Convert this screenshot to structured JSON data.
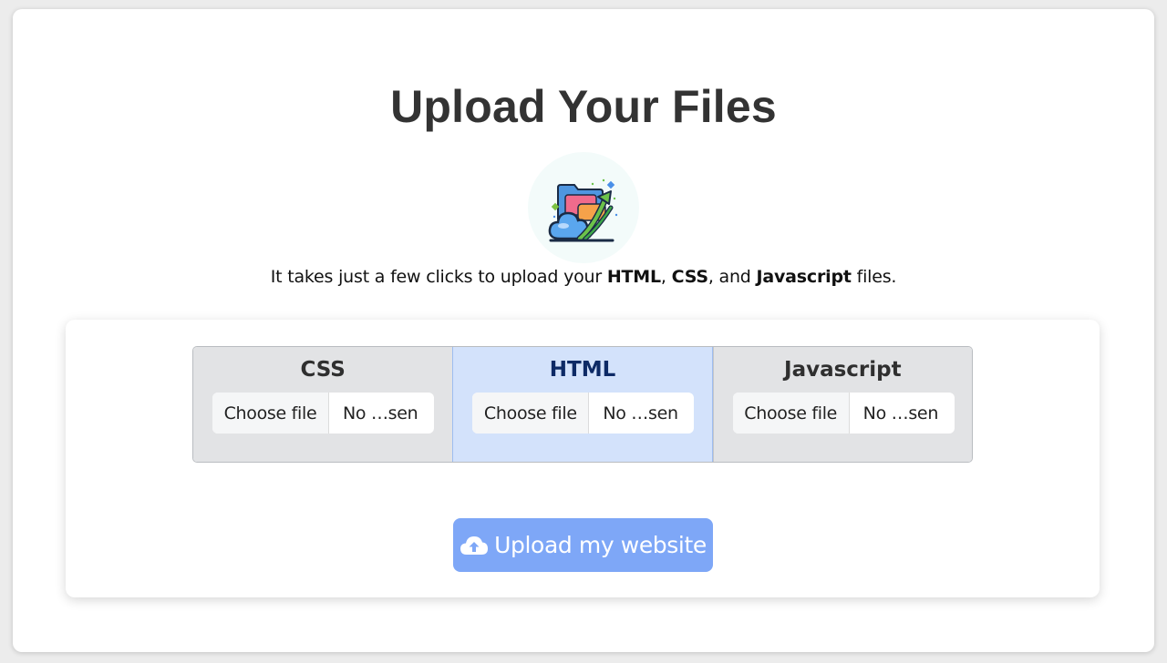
{
  "page": {
    "title": "Upload Your Files",
    "subtitle_prefix": "It takes just a few clicks to upload your ",
    "subtitle_html": "HTML",
    "subtitle_sep1": ", ",
    "subtitle_css": "CSS",
    "subtitle_sep2": ", and ",
    "subtitle_js": "Javascript",
    "subtitle_suffix": " files."
  },
  "logo": {
    "icon": "cloud-folder-upload-icon"
  },
  "tabs": [
    {
      "label": "CSS",
      "active": false,
      "choose_label": "Choose file",
      "file_name": "No …sen"
    },
    {
      "label": "HTML",
      "active": true,
      "choose_label": "Choose file",
      "file_name": "No …sen"
    },
    {
      "label": "Javascript",
      "active": false,
      "choose_label": "Choose file",
      "file_name": "No …sen"
    }
  ],
  "upload_button": {
    "label": "Upload my website",
    "icon": "cloud-upload-icon"
  },
  "colors": {
    "accent": "#7ea7f7",
    "active_tab": "#d3e2fb",
    "inactive_tab": "#e2e3e5",
    "title": "#333333"
  }
}
